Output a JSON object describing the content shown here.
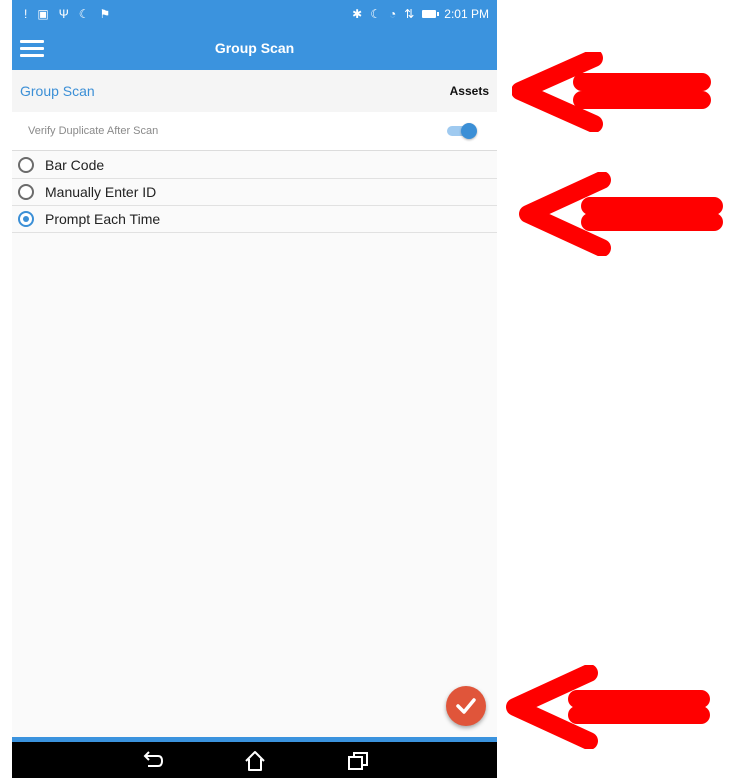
{
  "status_bar": {
    "time": "2:01 PM",
    "left_icons": [
      "notification-icon",
      "image-icon",
      "app-icon",
      "moon-icon",
      "flag-icon"
    ],
    "right_icons": [
      "bluetooth-icon",
      "moon-icon",
      "wifi-icon",
      "data-arrows-icon",
      "battery-icon"
    ]
  },
  "app_bar": {
    "title": "Group Scan",
    "menu_icon": "hamburger-menu-icon"
  },
  "header": {
    "title": "Group Scan",
    "right_label": "Assets"
  },
  "verify": {
    "label": "Verify Duplicate After Scan",
    "enabled": true
  },
  "options": [
    {
      "label": "Bar Code",
      "selected": false
    },
    {
      "label": "Manually Enter ID",
      "selected": false
    },
    {
      "label": "Prompt Each Time",
      "selected": true
    }
  ],
  "fab": {
    "icon": "checkmark-icon"
  },
  "nav_bar": {
    "icons": [
      "back-icon",
      "home-icon",
      "recents-icon"
    ]
  },
  "colors": {
    "primary": "#3b93de",
    "accent": "#e0553a",
    "annotation": "#ff0000"
  }
}
